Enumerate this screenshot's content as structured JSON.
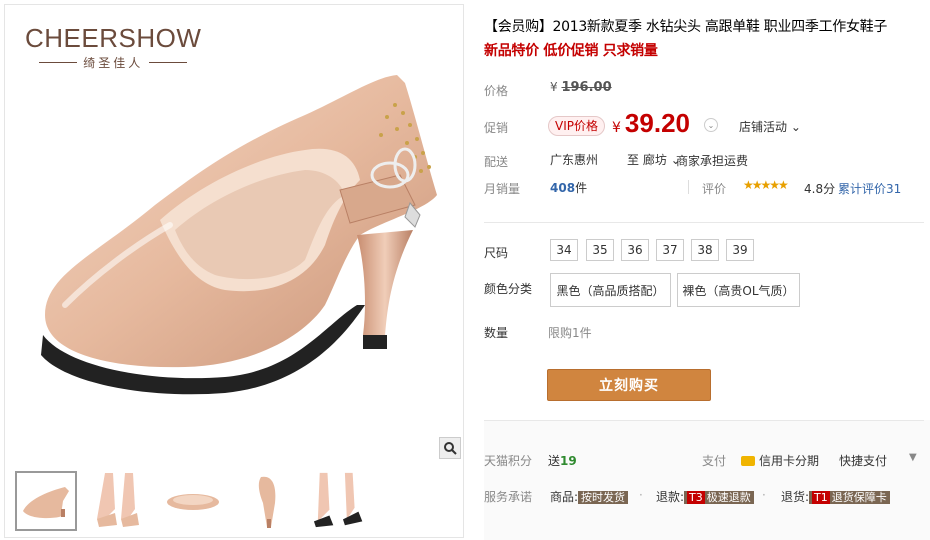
{
  "brand": {
    "logo_text": "CHEERSHOW",
    "logo_sub": "绮圣佳人"
  },
  "product": {
    "title": "【会员购】2013新款夏季 水钻尖头 高跟单鞋 职业四季工作女鞋子",
    "subtitle": "新品特价 低价促销 只求销量"
  },
  "price": {
    "label": "价格",
    "currency": "¥",
    "original": "196.00",
    "promo_label": "促销",
    "vip_badge": "VIP价格",
    "promo": "39.20",
    "store_activity": "店铺活动"
  },
  "shipping": {
    "label": "配送",
    "from": "广东惠州",
    "to_word": "至",
    "to": "廊坊",
    "fee": "商家承担运费"
  },
  "sales": {
    "label": "月销量",
    "count": "408",
    "unit": "件",
    "rating_label": "评价",
    "stars": "★★★★★",
    "score": "4.8分",
    "review_link": "累计评价31"
  },
  "options": {
    "size_label": "尺码",
    "sizes": [
      "34",
      "35",
      "36",
      "37",
      "38",
      "39"
    ],
    "color_label": "颜色分类",
    "colors": [
      "黑色（高品质搭配）",
      "裸色（高贵OL气质）"
    ],
    "qty_label": "数量",
    "limit": "限购1件"
  },
  "actions": {
    "buy_now": "立刻购买"
  },
  "footer": {
    "points_label": "天猫积分",
    "points_prefix": "送",
    "points": "19",
    "pay_label": "支付",
    "credit_installment": "信用卡分期",
    "fast_pay": "快捷支付",
    "promise_label": "服务承诺",
    "promise_goods_prefix": "商品:",
    "promise_goods_tag": "按时发货",
    "promise_refund_prefix": "退款:",
    "promise_refund_t": "T3",
    "promise_refund_tag": "极速退款",
    "promise_return_prefix": "退货:",
    "promise_return_t": "T1",
    "promise_return_tag": "退货保障卡"
  },
  "colors": {
    "price_red": "#c40000",
    "buy_button": "#d0853f",
    "shoe_nude": "#e9c2a9",
    "link_blue": "#3366aa"
  }
}
